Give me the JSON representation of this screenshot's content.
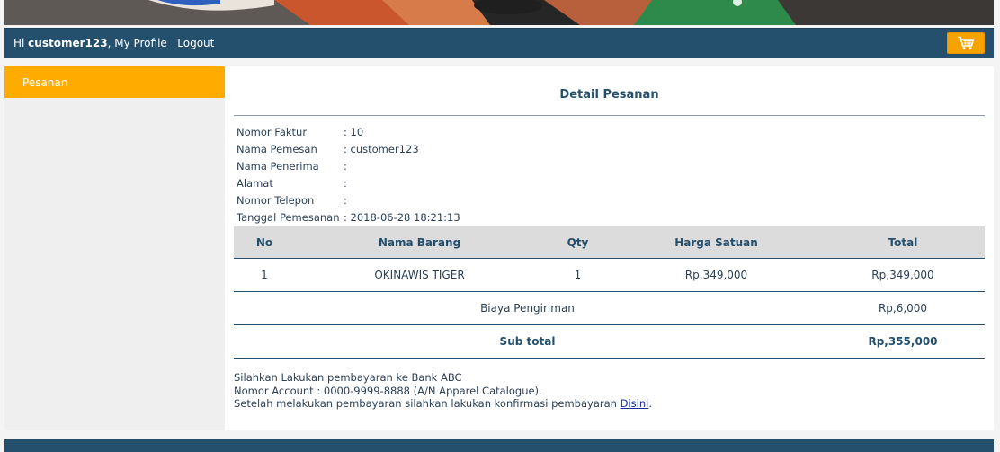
{
  "nav": {
    "greeting_prefix": "Hi ",
    "username": "customer123",
    "separator": ",",
    "my_profile": "My Profile",
    "logout": "Logout"
  },
  "sidebar": {
    "items": [
      {
        "label": "Pesanan"
      }
    ]
  },
  "main": {
    "title": "Detail Pesanan",
    "info": [
      {
        "label": "Nomor Faktur",
        "value": ": 10"
      },
      {
        "label": "Nama Pemesan",
        "value": ": customer123"
      },
      {
        "label": "Nama Penerima",
        "value": ":"
      },
      {
        "label": "Alamat",
        "value": ":"
      },
      {
        "label": "Nomor Telepon",
        "value": ":"
      },
      {
        "label": "Tanggal Pemesanan",
        "value": ": 2018-06-28 18:21:13"
      }
    ],
    "table": {
      "headers": {
        "no": "No",
        "nama": "Nama Barang",
        "qty": "Qty",
        "harga": "Harga Satuan",
        "total": "Total"
      },
      "rows": [
        {
          "no": "1",
          "nama": "OKINAWIS TIGER",
          "qty": "1",
          "harga": "Rp,349,000",
          "total": "Rp,349,000"
        }
      ],
      "shipping_label": "Biaya Pengiriman",
      "shipping_value": "Rp,6,000",
      "subtotal_label": "Sub total",
      "subtotal_value": "Rp,355,000"
    },
    "note": {
      "line1": "Silahkan Lakukan pembayaran ke Bank ABC",
      "line2": "Nomor Account : 0000-9999-8888 (A/N Apparel Catalogue).",
      "line3_prefix": "Setelah melakukan pembayaran silahkan lakukan konfirmasi pembayaran ",
      "link": "Disini",
      "line3_suffix": "."
    }
  },
  "colors": {
    "nav_bg": "#24506e",
    "accent_orange": "#ffab00",
    "cart_bg": "#f6a200",
    "link": "#1a2e9a"
  },
  "icons": {
    "cart": "shopping-cart-icon"
  }
}
